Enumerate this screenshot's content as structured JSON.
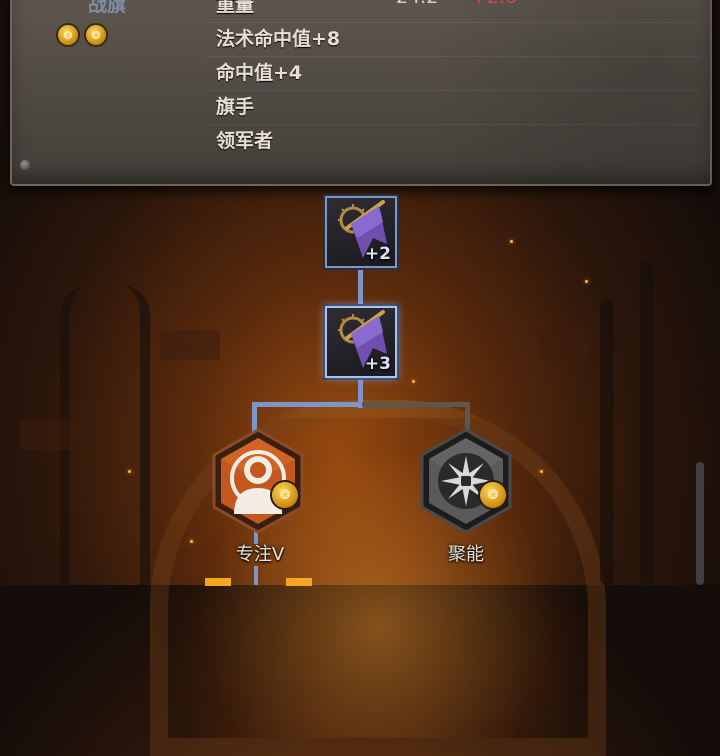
{
  "item": {
    "name": "战旗",
    "gem_slots": [
      {
        "icon": "gold-gem-icon",
        "glyph": "❂"
      },
      {
        "icon": "gold-gem-icon",
        "glyph": "❂"
      }
    ]
  },
  "stats": [
    {
      "label": "重量",
      "value": "24.2",
      "delta": "+2.6"
    },
    {
      "label": "法术命中值+8"
    },
    {
      "label": "命中值+4"
    },
    {
      "label": "旗手"
    },
    {
      "label": "领军者"
    }
  ],
  "upgrade_tree": {
    "nodes": [
      {
        "icon": "purple-war-banner-icon",
        "level": "+2",
        "state": "unlocked"
      },
      {
        "icon": "purple-war-banner-icon",
        "level": "+3",
        "state": "selected"
      }
    ],
    "branches": [
      {
        "name": "专注V",
        "icon": "focus-person-icon",
        "badge_icon": "gold-gem-icon",
        "badge_glyph": "❂",
        "state": "active",
        "color": "#c2571f"
      },
      {
        "name": "聚能",
        "icon": "burst-icon",
        "badge_icon": "gold-gem-icon",
        "badge_glyph": "❂",
        "state": "inactive",
        "color": "#5a5a5a"
      }
    ]
  },
  "colors": {
    "accent_blue": "#7b96c9",
    "penalty_red": "#e34a4a",
    "gem_gold": "#f0b52a"
  }
}
